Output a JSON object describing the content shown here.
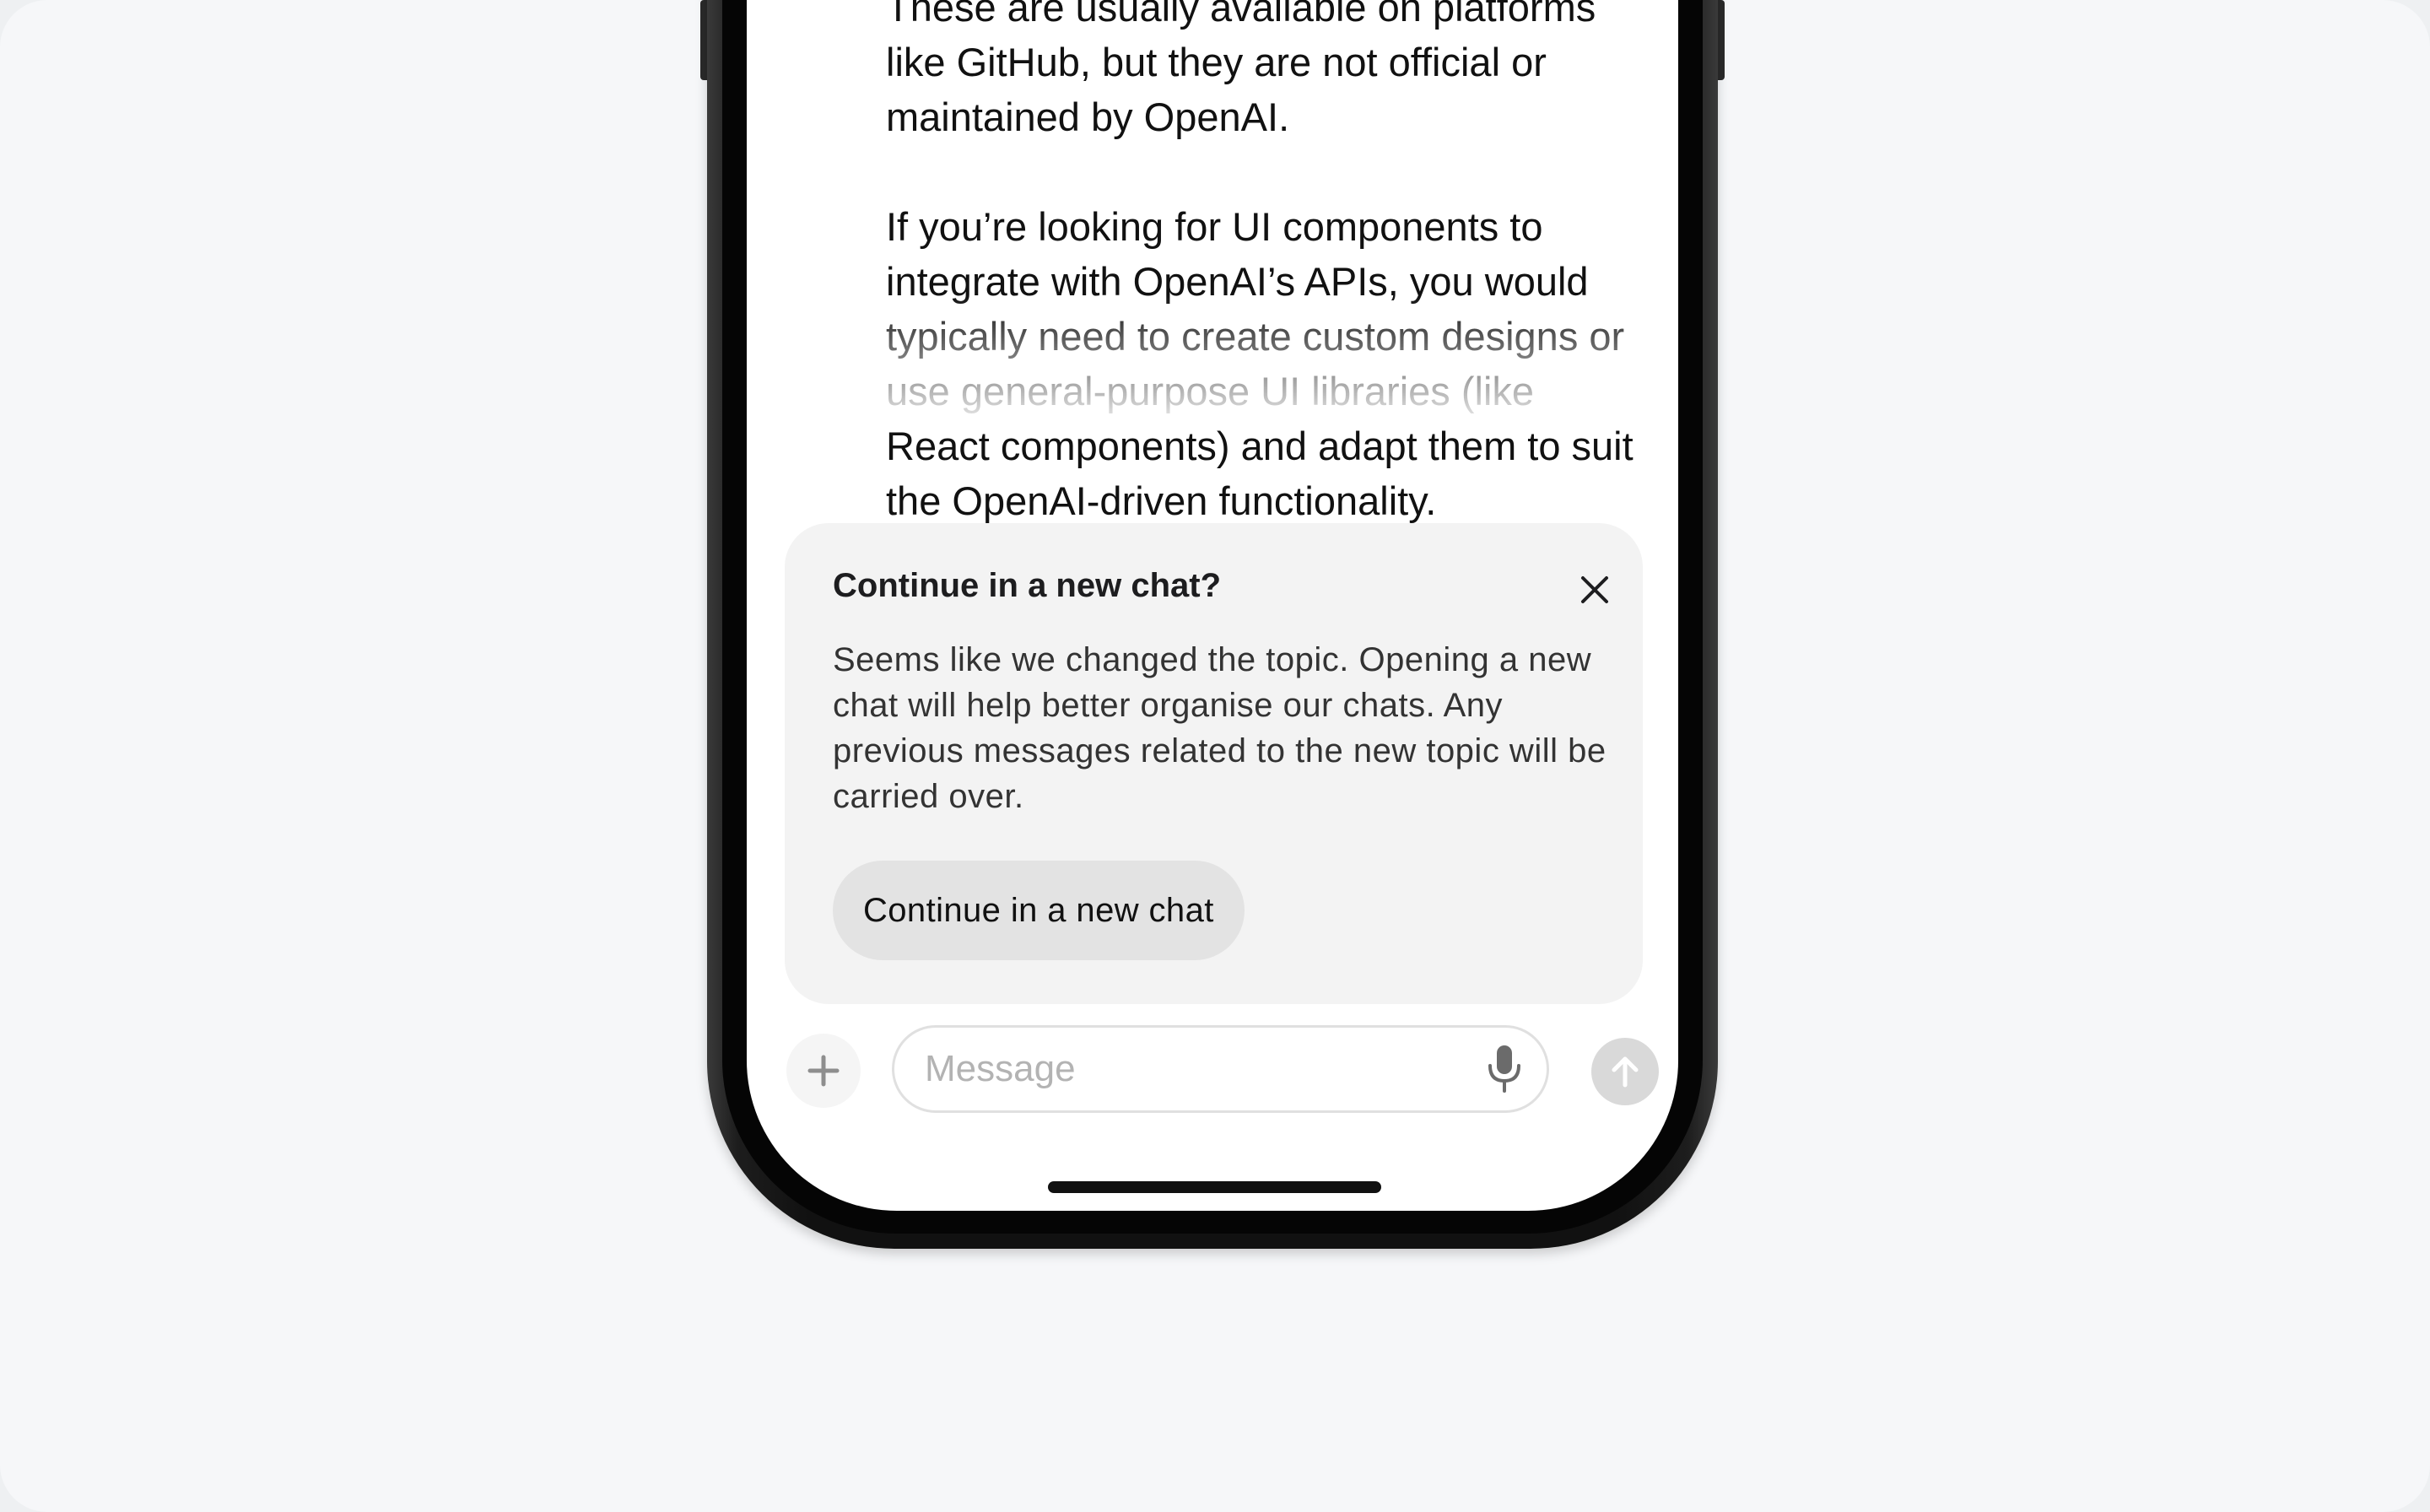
{
  "chat": {
    "paragraph_1": "These are usually available on platforms like GitHub, but they are not official or maintained by OpenAI.",
    "paragraph_2": "If you’re looking for UI components to integrate with OpenAI’s APIs, you would typically need to create custom designs or use general-purpose UI libraries (like React components) and adapt them to suit the OpenAI-driven functionality."
  },
  "prompt_card": {
    "title": "Continue in a new chat?",
    "body": "Seems like we changed the topic. Opening a new chat will help better organise our chats. Any previous messages related to the new topic will be carried over.",
    "button_label": "Continue in a new chat",
    "close_icon": "close-icon"
  },
  "composer": {
    "placeholder": "Message",
    "plus_icon": "plus-icon",
    "mic_icon": "microphone-icon",
    "send_icon": "arrow-up-icon"
  },
  "colors": {
    "card_background": "#f3f3f3",
    "button_background": "#e3e3e3",
    "send_disabled": "#d9d9d9",
    "page_background": "#f6f7f9"
  }
}
